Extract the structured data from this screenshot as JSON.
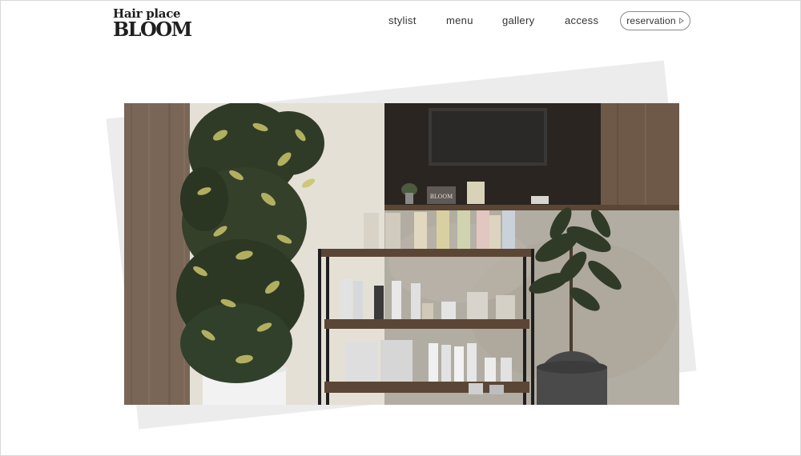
{
  "header": {
    "logo_line1": "Hair place",
    "logo_line2": "BLOOM"
  },
  "nav": {
    "items": [
      {
        "label": "stylist"
      },
      {
        "label": "menu"
      },
      {
        "label": "gallery"
      },
      {
        "label": "access"
      }
    ],
    "reservation_label": "reservation"
  },
  "hero": {
    "sign_text": "BLOOM",
    "colors": {
      "wood": "#7a6656",
      "dark_panel": "#2b2521",
      "concrete": "#b2ada3",
      "wall": "#e4e0d6",
      "foliage": "#2f3b26",
      "foliage_light": "#c9c46a",
      "shelf": "#5b4636",
      "pot": "#4a4a4a"
    }
  }
}
